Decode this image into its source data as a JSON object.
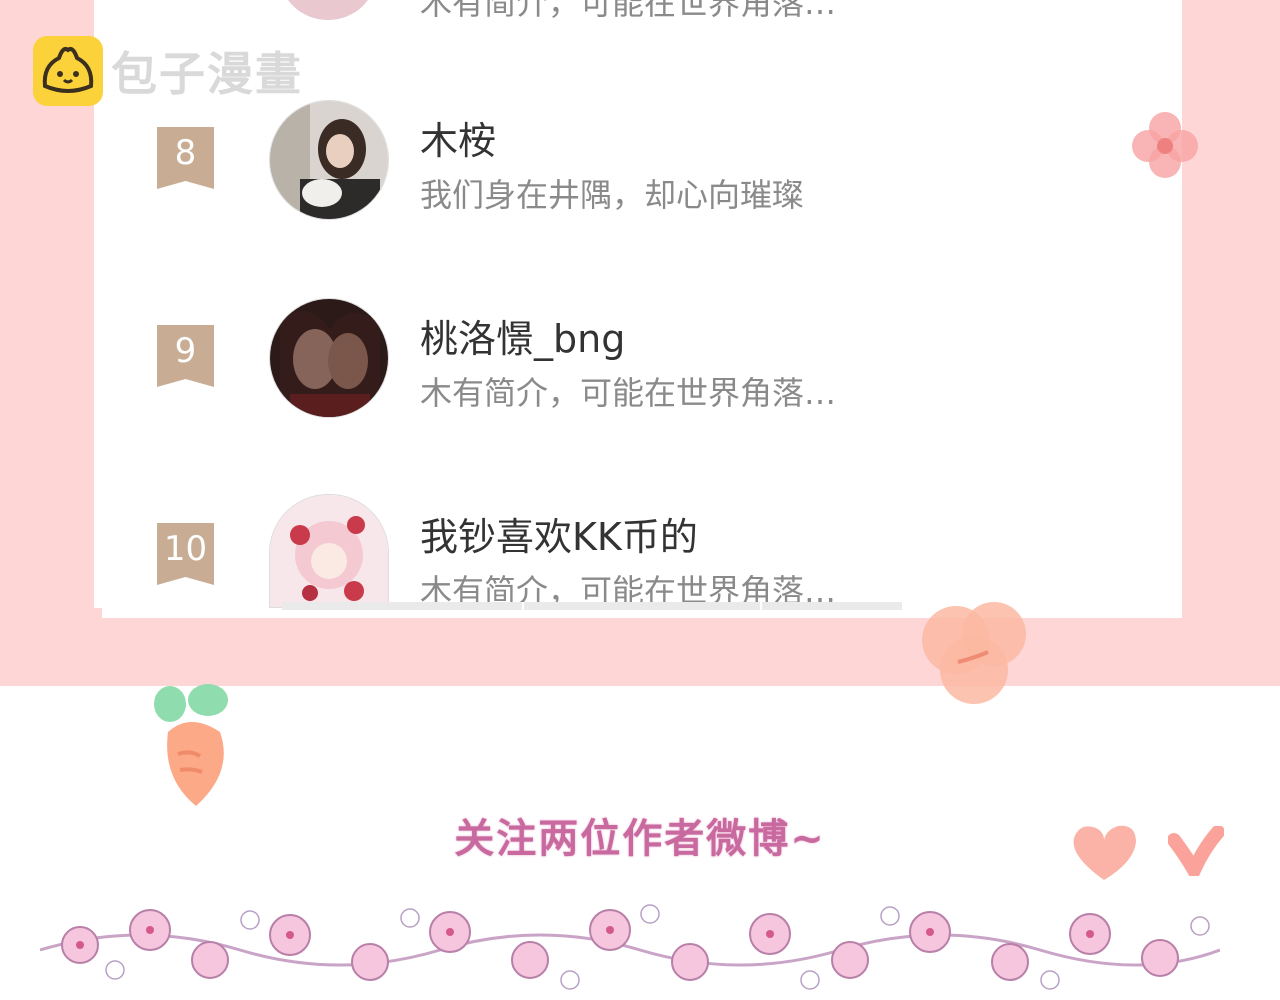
{
  "watermark": {
    "text": "包子漫畫"
  },
  "partial_row": {
    "bio": "木有简介，可能在世界角落…"
  },
  "ranking": [
    {
      "rank": "8",
      "name": "木桉",
      "bio": "我们身在井隅，却心向璀璨"
    },
    {
      "rank": "9",
      "name": "桃洛憬_bng",
      "bio": "木有简介，可能在世界角落…"
    },
    {
      "rank": "10",
      "name": "我钞喜欢KK币的",
      "bio": "木有简介，可能在世界角落…"
    }
  ],
  "follow_text": "关注两位作者微博~",
  "colors": {
    "band": "#ffd6d6",
    "ribbon": "#c8ad94",
    "follow": "#c86aa0",
    "logo": "#fcd23b"
  }
}
